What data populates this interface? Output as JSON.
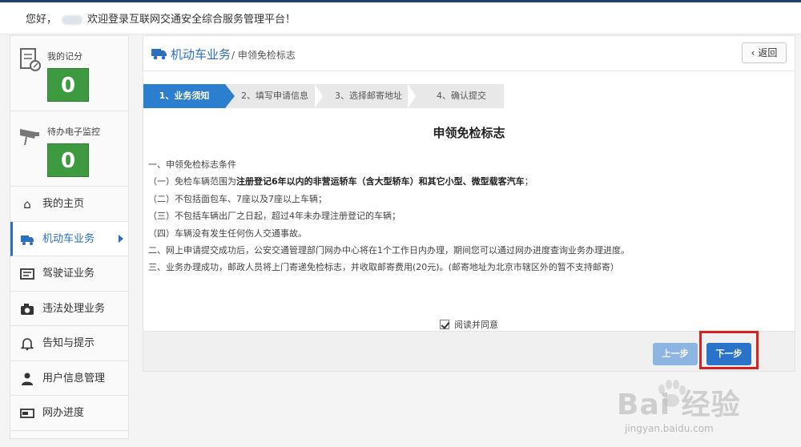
{
  "greeting": {
    "before": "您好，",
    "after": "欢迎登录互联网交通安全综合服务管理平台！"
  },
  "sidebar": {
    "stats": [
      {
        "label": "我的记分",
        "value": "0",
        "icon": "score-card-icon"
      },
      {
        "label": "待办电子监控",
        "value": "0",
        "icon": "camera-monitor-icon"
      }
    ],
    "items": [
      {
        "label": "我的主页",
        "icon": "home-icon"
      },
      {
        "label": "机动车业务",
        "icon": "truck-icon"
      },
      {
        "label": "驾驶证业务",
        "icon": "license-card-icon"
      },
      {
        "label": "违法处理业务",
        "icon": "camera-icon"
      },
      {
        "label": "告知与提示",
        "icon": "bell-icon"
      },
      {
        "label": "用户信息管理",
        "icon": "user-icon"
      },
      {
        "label": "网办进度",
        "icon": "progress-icon"
      }
    ]
  },
  "breadcrumb": {
    "section": "机动车业务",
    "sep_page": "/ 申领免检标志",
    "back": "返回"
  },
  "steps": [
    "1、业务须知",
    "2、填写申请信息",
    "3、选择邮寄地址",
    "4、确认提交"
  ],
  "title": "申领免检标志",
  "content": {
    "h1": "一、申领免检标志条件",
    "c1_pre": "（一）免检车辆范围为",
    "c1_bold": "注册登记6年以内的非营运轿车（含大型轿车）和其它小型、微型载客汽车",
    "c1_post": "；",
    "c2": "（二）不包括面包车、7座以及7座以上车辆；",
    "c3": "（三）不包括车辆出厂之日起，超过4年未办理注册登记的车辆；",
    "c4": "（四）车辆没有发生任何伤人交通事故。",
    "h2": "二、网上申请提交成功后，公安交通管理部门网办中心将在1个工作日内办理，期间您可以通过网办进度查询业务办理进度。",
    "h3": "三、业务办理成功，邮政人员将上门寄递免检标志，并收取邮寄费用(20元)。(邮寄地址为北京市辖区外的暂不支持邮寄）"
  },
  "agree_label": "阅读并同意",
  "buttons": {
    "prev": "上一步",
    "next": "下一步"
  },
  "watermark": {
    "logo": "Bai 经验",
    "url": "jingyan.baidu.com"
  },
  "colors": {
    "accent": "#2c7fce",
    "stat_green": "#3d9a3f",
    "highlight": "#d91f1f"
  }
}
